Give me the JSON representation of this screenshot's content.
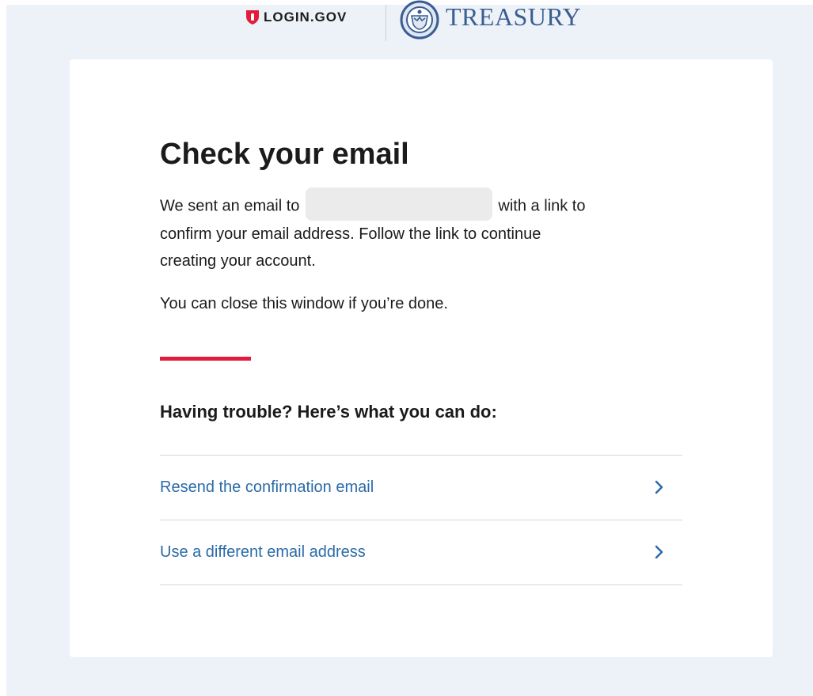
{
  "header": {
    "logingov_label": "LOGIN.GOV",
    "partner_label": "TREASURY"
  },
  "main": {
    "title": "Check your email",
    "intro_prefix": "We sent an email to",
    "intro_suffix": "with a link to",
    "intro_line2": "confirm your email address. Follow the link to continue",
    "intro_line3": "creating your account.",
    "close_note": "You can close this window if you’re done.",
    "trouble_heading": "Having trouble? Here’s what you can do:",
    "options": [
      {
        "label": "Resend the confirmation email",
        "icon": "chevron-right-icon"
      },
      {
        "label": "Use a different email address",
        "icon": "chevron-right-icon"
      }
    ]
  },
  "colors": {
    "page_background": "#edf2f8",
    "accent_red": "#e21c3d",
    "link_blue": "#2b6ba8",
    "treasury_blue": "#3b5d93",
    "text": "#1b1b1b"
  }
}
